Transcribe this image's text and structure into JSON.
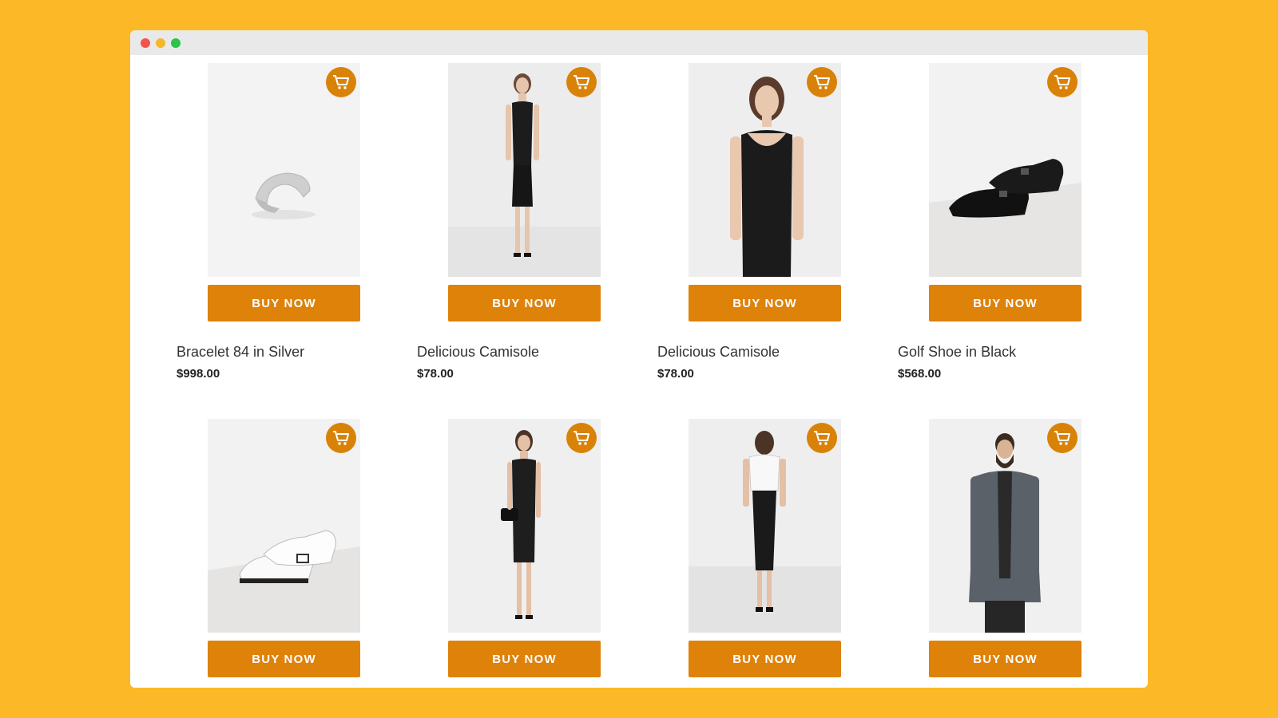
{
  "theme": {
    "background": "#FDB827",
    "accent": "#DE820A"
  },
  "products": [
    {
      "name": "Bracelet 84 in Silver",
      "price": "$998.00",
      "buy_label": "BUY NOW",
      "image": "silver-cuff-bracelet",
      "cart_icon": "cart-icon"
    },
    {
      "name": "Delicious Camisole",
      "price": "$78.00",
      "buy_label": "BUY NOW",
      "image": "model-black-camisole-dress",
      "cart_icon": "cart-icon"
    },
    {
      "name": "Delicious Camisole",
      "price": "$78.00",
      "buy_label": "BUY NOW",
      "image": "model-black-camisole-closeup",
      "cart_icon": "cart-icon"
    },
    {
      "name": "Golf Shoe in Black",
      "price": "$568.00",
      "buy_label": "BUY NOW",
      "image": "black-leather-shoes",
      "cart_icon": "cart-icon"
    },
    {
      "buy_label": "BUY NOW",
      "image": "white-leather-shoes",
      "cart_icon": "cart-icon"
    },
    {
      "buy_label": "BUY NOW",
      "image": "model-black-leather-dress",
      "cart_icon": "cart-icon"
    },
    {
      "buy_label": "BUY NOW",
      "image": "model-white-top-black-skirt",
      "cart_icon": "cart-icon"
    },
    {
      "buy_label": "BUY NOW",
      "image": "bearded-man-grey-blazer",
      "cart_icon": "cart-icon"
    }
  ]
}
